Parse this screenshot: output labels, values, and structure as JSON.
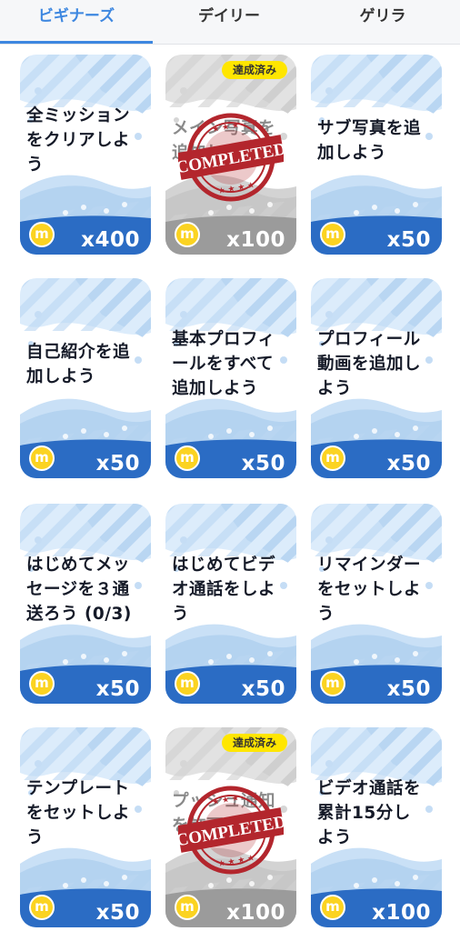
{
  "tabs": [
    {
      "label": "ビギナーズ",
      "active": true
    },
    {
      "label": "デイリー",
      "active": false
    },
    {
      "label": "ゲリラ",
      "active": false
    }
  ],
  "colors": {
    "accent": "#3d87e0",
    "reward_bar": "#2b6cc4",
    "completed_bar": "#9b9b9b",
    "coin": "#fbd321",
    "badge": "#ffe600",
    "stamp": "#b3262d"
  },
  "coin_symbol": "m",
  "stamp_text": "COMPLETED",
  "missions": [
    {
      "title": "全ミッション\nをクリアしよ\nう",
      "reward": "x400",
      "completed": false
    },
    {
      "title": "メイン写真を\n追加しよう",
      "reward": "x100",
      "completed": true,
      "badge": "達成済み"
    },
    {
      "title": "サブ写真を追\n加しよう",
      "reward": "x50",
      "completed": false
    },
    {
      "title": "自己紹介を追\n加しよう",
      "reward": "x50",
      "completed": false
    },
    {
      "title": "基本プロフィ\nールをすべて\n追加しよう",
      "reward": "x50",
      "completed": false
    },
    {
      "title": "プロフィール\n動画を追加し\nよう",
      "reward": "x50",
      "completed": false
    },
    {
      "title": "はじめてメッ\nセージを３通\n送ろう (0/3)",
      "reward": "x50",
      "completed": false
    },
    {
      "title": "はじめてビデ\nオ通話をしよ\nう",
      "reward": "x50",
      "completed": false
    },
    {
      "title": "リマインダー\nをセットしよ\nう",
      "reward": "x50",
      "completed": false
    },
    {
      "title": "テンプレート\nをセットしよ\nう",
      "reward": "x50",
      "completed": false
    },
    {
      "title": "プッシュ通知\nを許可しよう",
      "reward": "x100",
      "completed": true,
      "badge": "達成済み"
    },
    {
      "title": "ビデオ通話を\n累計15分し\nよう",
      "reward": "x100",
      "completed": false
    }
  ]
}
